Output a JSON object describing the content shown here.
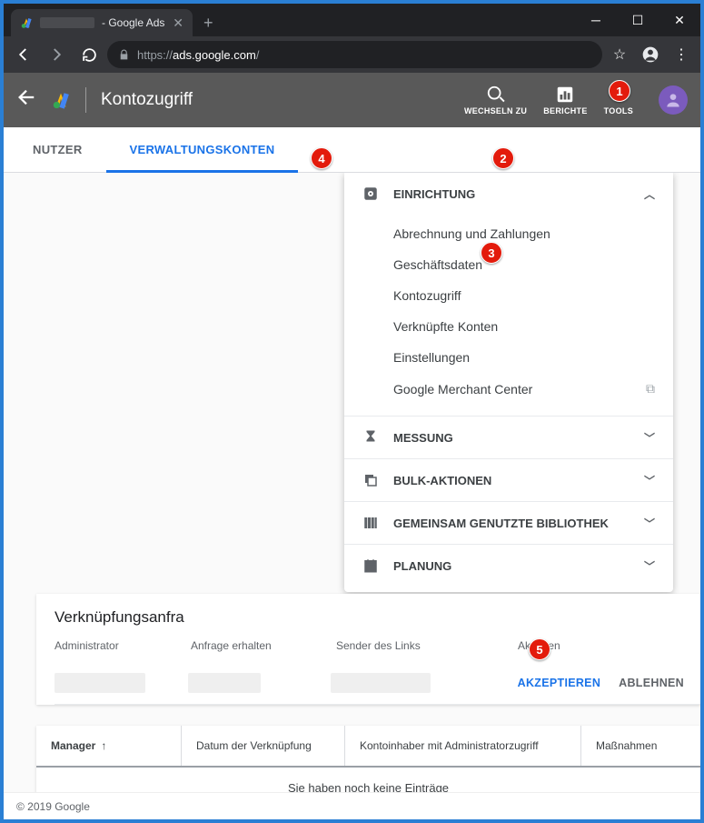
{
  "browser": {
    "tab_title_suffix": "- Google Ads",
    "url_prefix": "https://",
    "url_host": "ads.google.com",
    "url_path": "/"
  },
  "appbar": {
    "title": "Kontozugriff",
    "actions": {
      "search": "WECHSELN ZU",
      "reports": "BERICHTE",
      "tools": "TOOLS"
    }
  },
  "tabs": {
    "users": "NUTZER",
    "mgmt": "VERWALTUNGSKONTEN"
  },
  "tools_menu": {
    "setup": {
      "label": "EINRICHTUNG",
      "items": {
        "billing": "Abrechnung und Zahlungen",
        "bizdata": "Geschäftsdaten",
        "access": "Kontozugriff",
        "linked": "Verknüpfte Konten",
        "settings": "Einstellungen",
        "merchant": "Google Merchant Center"
      }
    },
    "measure": "MESSUNG",
    "bulk": "BULK-AKTIONEN",
    "shared": "GEMEINSAM GENUTZTE BIBLIOTHEK",
    "planning": "PLANUNG"
  },
  "link_requests": {
    "title": "Verknüpfungsanfra",
    "cols": {
      "admin": "Administrator",
      "received": "Anfrage erhalten",
      "sender": "Sender des Links",
      "actions": "Aktionen"
    },
    "btn_accept": "AKZEPTIEREN",
    "btn_decline": "ABLEHNEN"
  },
  "managers_table": {
    "cols": {
      "manager": "Manager",
      "linkdate": "Datum der Verknüpfung",
      "owner": "Kontoinhaber mit Administratorzugriff",
      "actions": "Maßnahmen"
    },
    "empty": "Sie haben noch keine Einträge"
  },
  "footer": "© 2019 Google",
  "badges": {
    "b1": "1",
    "b2": "2",
    "b3": "3",
    "b4": "4",
    "b5": "5"
  }
}
